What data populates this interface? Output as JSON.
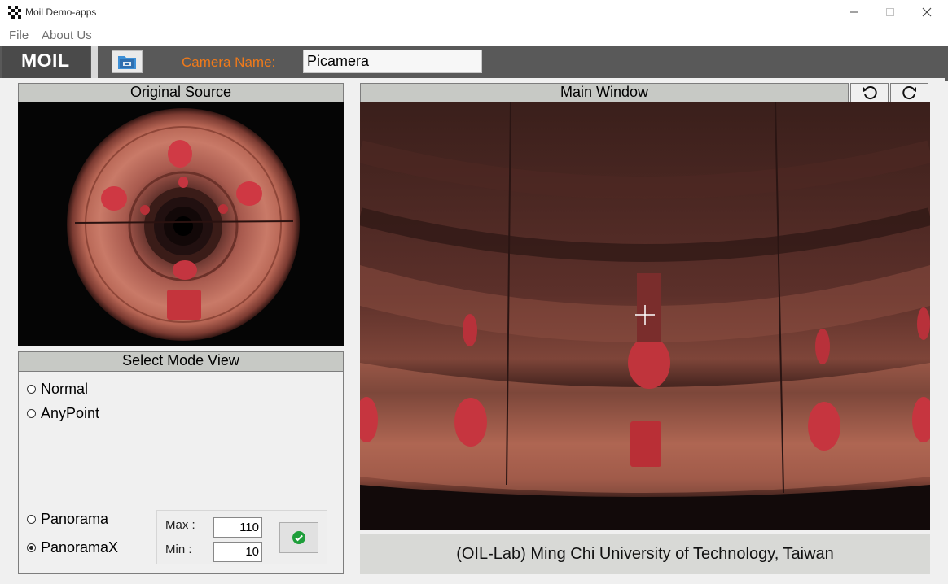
{
  "window": {
    "title": "Moil Demo-apps"
  },
  "menu": {
    "items": [
      {
        "label": "File"
      },
      {
        "label": "About Us"
      }
    ]
  },
  "toolbar": {
    "logo": "MOIL",
    "open_icon": "folder-open-icon",
    "camera_label": "Camera Name:",
    "camera_name": "Picamera"
  },
  "original_source": {
    "title": "Original Source"
  },
  "mode_view": {
    "title": "Select Mode View",
    "options": [
      {
        "label": "Normal",
        "selected": false
      },
      {
        "label": "AnyPoint",
        "selected": false
      },
      {
        "label": "Panorama",
        "selected": false
      },
      {
        "label": "PanoramaX",
        "selected": true
      }
    ],
    "max_label": "Max :",
    "min_label": "Min  :",
    "max_value": "110",
    "min_value": "10",
    "apply_icon": "check-circle-icon"
  },
  "main_window": {
    "title": "Main Window",
    "rotate_left_icon": "rotate-left-icon",
    "rotate_right_icon": "rotate-right-icon"
  },
  "footer": {
    "text": "(OIL-Lab) Ming Chi University of Technology, Taiwan"
  },
  "colors": {
    "toolbar_bg": "#595959",
    "camera_label": "#f07a1a",
    "header_bg": "#c7c9c5",
    "footer_bg": "#d8d9d6",
    "apply_check": "#1e9e3a"
  }
}
